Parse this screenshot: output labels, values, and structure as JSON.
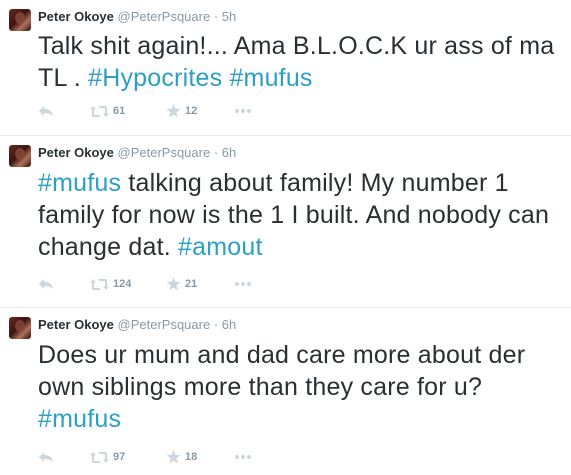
{
  "tweets": [
    {
      "fullname": "Peter Okoye",
      "handle": "@PeterPsquare",
      "time_sep": " · ",
      "time": "5h",
      "text_plain": "Talk shit again!... Ama B.L.O.C.K ur ass of ma TL . ",
      "hashtag1": "#Hypocrites",
      "hashtag2": "#mufus",
      "retweets": "61",
      "favorites": "12"
    },
    {
      "fullname": "Peter Okoye",
      "handle": "@PeterPsquare",
      "time_sep": " · ",
      "time": "6h",
      "hashtag_lead": "#mufus",
      "text_plain": " talking about family! My number 1 family for now is the 1 I built. And nobody can change dat. ",
      "hashtag_tail": "#amout",
      "retweets": "124",
      "favorites": "21"
    },
    {
      "fullname": "Peter Okoye",
      "handle": "@PeterPsquare",
      "time_sep": " · ",
      "time": "6h",
      "text_plain": "Does ur mum and dad care more about der own siblings more than they care for u? ",
      "hashtag_tail": "#mufus",
      "retweets": "97",
      "favorites": "18"
    }
  ],
  "icons": {
    "reply": "reply-icon",
    "retweet": "retweet-icon",
    "favorite": "star-icon",
    "more": "more-dots-icon"
  },
  "colors": {
    "hashtag": "#2b9fc4",
    "text": "#292f33",
    "meta": "#8899a6",
    "icon": "#ccd6dd",
    "divider": "#e1e8ed"
  }
}
